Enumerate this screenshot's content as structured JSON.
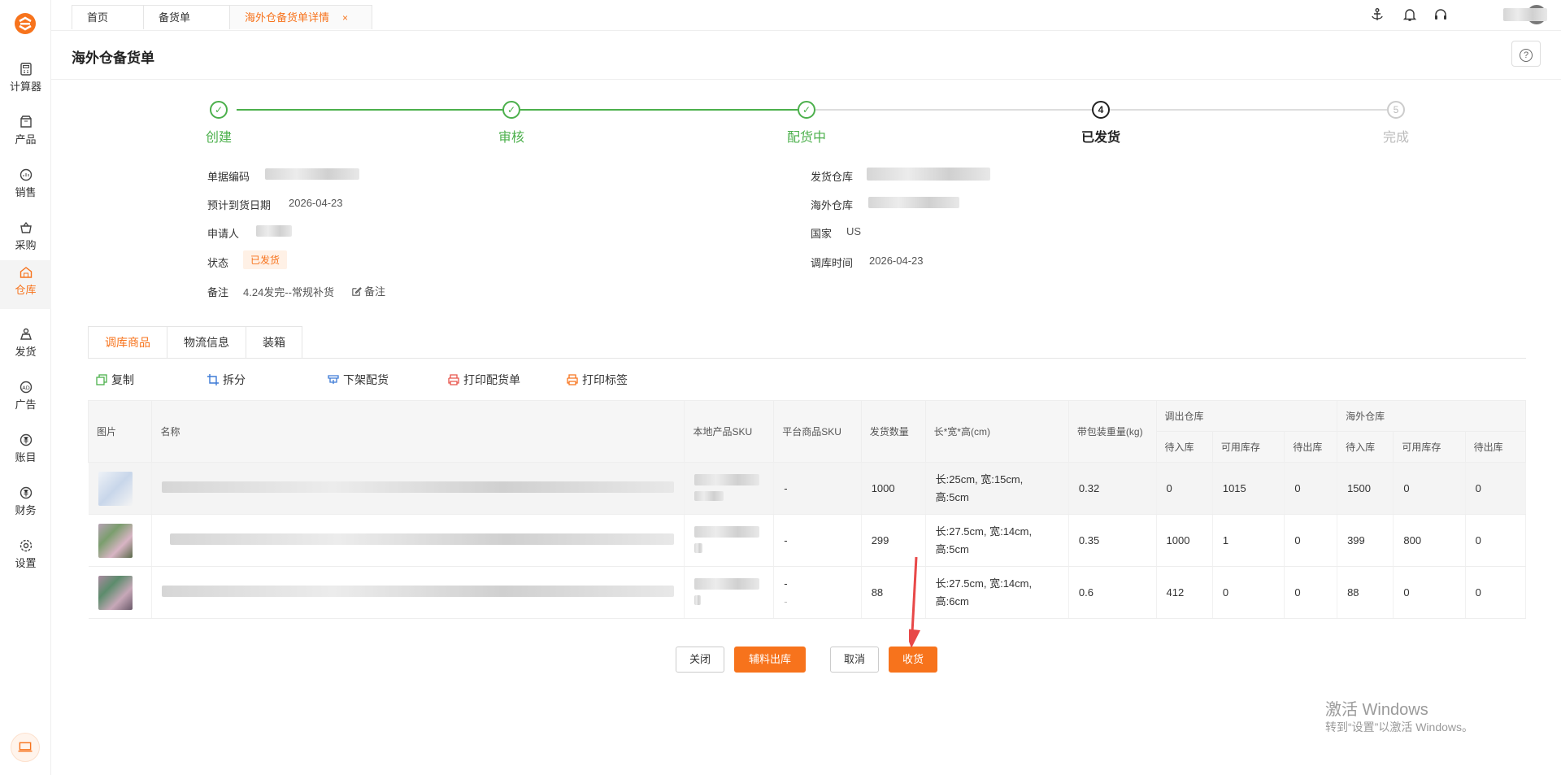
{
  "sidebar": {
    "items": [
      {
        "label": "计算器",
        "icon": "calculator-icon"
      },
      {
        "label": "产品",
        "icon": "product-icon"
      },
      {
        "label": "销售",
        "icon": "sales-icon"
      },
      {
        "label": "采购",
        "icon": "purchase-icon"
      },
      {
        "label": "仓库",
        "icon": "warehouse-icon"
      },
      {
        "label": "发货",
        "icon": "shipping-icon"
      },
      {
        "label": "广告",
        "icon": "ad-icon"
      },
      {
        "label": "账目",
        "icon": "ledger-icon"
      },
      {
        "label": "财务",
        "icon": "finance-icon"
      },
      {
        "label": "设置",
        "icon": "settings-icon"
      }
    ],
    "active": "仓库"
  },
  "tabs": [
    {
      "label": "首页"
    },
    {
      "label": "备货单"
    },
    {
      "label": "海外仓备货单详情",
      "close": "×"
    }
  ],
  "page": {
    "title": "海外仓备货单",
    "help": "?"
  },
  "steps": [
    {
      "label": "创建",
      "state": "done"
    },
    {
      "label": "审核",
      "state": "done"
    },
    {
      "label": "配货中",
      "state": "done"
    },
    {
      "label": "已发货",
      "number": "4",
      "state": "current"
    },
    {
      "label": "完成",
      "number": "5",
      "state": "pending"
    }
  ],
  "info": {
    "doc_code_label": "单据编码",
    "eta_label": "预计到货日期",
    "eta_value": "2026-04-23",
    "applicant_label": "申请人",
    "status_label": "状态",
    "status_value": "已发货",
    "remark_label": "备注",
    "remark_value": "4.24发完--常规补货",
    "remark_edit": "备注",
    "ship_wh_label": "发货仓库",
    "overseas_wh_label": "海外仓库",
    "country_label": "国家",
    "country_value": "US",
    "transfer_time_label": "调库时间",
    "transfer_time_value": "2026-04-23"
  },
  "detail_tabs": [
    "调库商品",
    "物流信息",
    "装箱"
  ],
  "actions": [
    "复制",
    "拆分",
    "下架配货",
    "打印配货单",
    "打印标签"
  ],
  "table": {
    "headers": {
      "image": "图片",
      "name": "名称",
      "local_sku": "本地产品SKU",
      "platform_sku": "平台商品SKU",
      "qty": "发货数量",
      "dims": "长*宽*高(cm)",
      "weight": "带包装重量(kg)",
      "out_wh": "调出仓库",
      "overseas_wh": "海外仓库",
      "pending_in": "待入库",
      "available": "可用库存",
      "pending_out": "待出库"
    },
    "rows": [
      {
        "platform_sku": "-",
        "qty": "1000",
        "dims1": "长:25cm, 宽:15cm,",
        "dims2": "高:5cm",
        "weight": "0.32",
        "o_in": "0",
        "o_avail": "1015",
        "o_out": "0",
        "w_in": "1500",
        "w_avail": "0",
        "w_out": "0"
      },
      {
        "platform_sku": "-",
        "qty": "299",
        "dims1": "长:27.5cm, 宽:14cm,",
        "dims2": "高:5cm",
        "weight": "0.35",
        "o_in": "1000",
        "o_avail": "1",
        "o_out": "0",
        "w_in": "399",
        "w_avail": "800",
        "w_out": "0"
      },
      {
        "platform_sku": "-",
        "platform_sku2": "-",
        "qty": "88",
        "dims1": "长:27.5cm, 宽:14cm,",
        "dims2": "高:6cm",
        "weight": "0.6",
        "o_in": "412",
        "o_avail": "0",
        "o_out": "0",
        "w_in": "88",
        "w_avail": "0",
        "w_out": "0"
      }
    ]
  },
  "buttons": {
    "close": "关闭",
    "aux_out": "辅料出库",
    "cancel": "取消",
    "receive": "收货"
  },
  "watermark": {
    "line1": "激活 Windows",
    "line2": "转到“设置”以激活 Windows。"
  },
  "colors": {
    "accent": "#f7731c",
    "success": "#4cb04c"
  }
}
